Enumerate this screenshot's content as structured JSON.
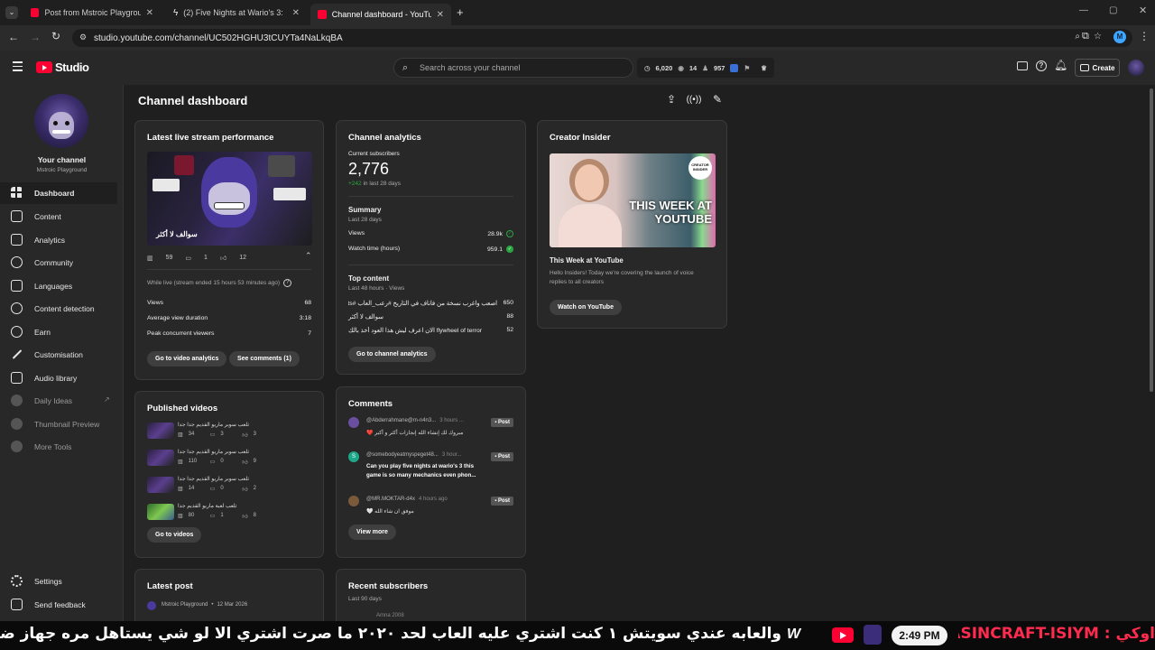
{
  "browser": {
    "tabs": [
      {
        "label": "Post from Mstroic Playground -"
      },
      {
        "label": "(2) Five Nights at Wario's 3: Cu"
      },
      {
        "label": "Channel dashboard - YouTube"
      }
    ],
    "url": "studio.youtube.com/channel/UC502HGHU3tCUYTa4NaLkqBA",
    "profile_letter": "M"
  },
  "header": {
    "logo_text": "Studio",
    "search_placeholder": "Search across your channel",
    "stat_views": "6,020",
    "stat_subs": "14",
    "stat_third": "957",
    "create_label": "Create"
  },
  "sidebar": {
    "channel_title": "Your channel",
    "channel_name": "Mstroic Playground",
    "items": [
      {
        "label": "Dashboard"
      },
      {
        "label": "Content"
      },
      {
        "label": "Analytics"
      },
      {
        "label": "Community"
      },
      {
        "label": "Languages"
      },
      {
        "label": "Content detection"
      },
      {
        "label": "Earn"
      },
      {
        "label": "Customisation"
      },
      {
        "label": "Audio library"
      },
      {
        "label": "Daily Ideas"
      },
      {
        "label": "Thumbnail Preview"
      },
      {
        "label": "More Tools"
      }
    ],
    "settings_label": "Settings",
    "feedback_label": "Send feedback"
  },
  "main": {
    "page_title": "Channel dashboard",
    "live": {
      "title": "Latest live stream performance",
      "thumb_caption": "سوالف لا أكثر",
      "stat_views": "59",
      "stat_comments": "1",
      "stat_likes": "12",
      "while_live": "While live (stream ended 15 hours 53 minutes ago)",
      "rows": [
        {
          "label": "Views",
          "value": "68"
        },
        {
          "label": "Average view duration",
          "value": "3:18"
        },
        {
          "label": "Peak concurrent viewers",
          "value": "7"
        }
      ],
      "btn_analytics": "Go to video analytics",
      "btn_comments": "See comments (1)"
    },
    "analytics": {
      "title": "Channel analytics",
      "subs_label": "Current subscribers",
      "subs_value": "2,776",
      "subs_change": "+242",
      "subs_change_suffix": "in last 28 days",
      "summary_title": "Summary",
      "summary_period": "Last 28 days",
      "summary_rows": [
        {
          "label": "Views",
          "value": "28.9k"
        },
        {
          "label": "Watch time (hours)",
          "value": "959.1"
        }
      ],
      "top_title": "Top content",
      "top_period": "Last 48 hours · Views",
      "top_rows": [
        {
          "label": "اصعب واغرب نسخة من فاناف في التاريخ #رعب_العاب #fivenights...",
          "value": "650"
        },
        {
          "label": "سوالف لا أكثر",
          "value": "88"
        },
        {
          "label": "الان اعرف ليش هذا العود أخذ بالك flywheel of terror",
          "value": "52"
        }
      ],
      "btn": "Go to channel analytics"
    },
    "insider": {
      "title": "Creator Insider",
      "thumb_text_1": "THIS WEEK AT",
      "thumb_text_2": "YOUTUBE",
      "badge_1": "CREATOR",
      "badge_2": "INSIDER",
      "video_title": "This Week at YouTube",
      "desc": "Hello Insiders! Today we're covering the launch of voice replies to all creators",
      "btn": "Watch on YouTube"
    },
    "published": {
      "title": "Published videos",
      "videos": [
        {
          "title": "ثلعب سوبر ماريو القديم جدا جدا",
          "views": "34",
          "comments": "3",
          "likes": "3"
        },
        {
          "title": "ثلعب سوبر ماريو القديم جدا جدا",
          "views": "110",
          "comments": "0",
          "likes": "9"
        },
        {
          "title": "ثلعب سوبر ماريو القديم جدا جدا",
          "views": "14",
          "comments": "0",
          "likes": "2"
        },
        {
          "title": "ثلعب لعبة ماريو القديم جدا",
          "views": "80",
          "comments": "1",
          "likes": "8"
        }
      ],
      "btn": "Go to videos"
    },
    "comments": {
      "title": "Comments",
      "items": [
        {
          "author": "@Abderrahmane@m-n4n3...",
          "time": "3 hours ...",
          "text": "مبروك لك إنشاء الله إنجازات أكثر و أكبر ❤️",
          "tag": "Post"
        },
        {
          "author": "@somebodyeatmyspeget48...",
          "time": "3 hour...",
          "text": "Can you play five nights at wario's 3 this game is so many mechanics even phon...",
          "tag": "Post"
        },
        {
          "author": "@MR.MOKTAR-d4x",
          "time": "4 hours ago",
          "text": "موفق ان شاء الله 🤍",
          "tag": "Post"
        }
      ],
      "btn": "View more"
    },
    "latest_post": {
      "title": "Latest post",
      "author": "Mstroic Playground",
      "date": "12 Mar 2026"
    },
    "recent_subs": {
      "title": "Recent subscribers",
      "period": "Last 90 days",
      "first_name": "Amna 2008"
    }
  },
  "ticker": {
    "text_right": "اوكي : ASSASINCRAFT-ISIYM",
    "time": "2:49 PM",
    "text_left": "والعابه عندي سويتش ١ كنت اشتري عليه العاب لحد ٢٠٢٠ ما صرت اشتري الا لو شي يستاهل مره جهاز ضعيف و"
  },
  "colors": {
    "youtube_red": "#ff0033",
    "positive_green": "#2ba640",
    "accent_blue": "#3ea6ff"
  }
}
